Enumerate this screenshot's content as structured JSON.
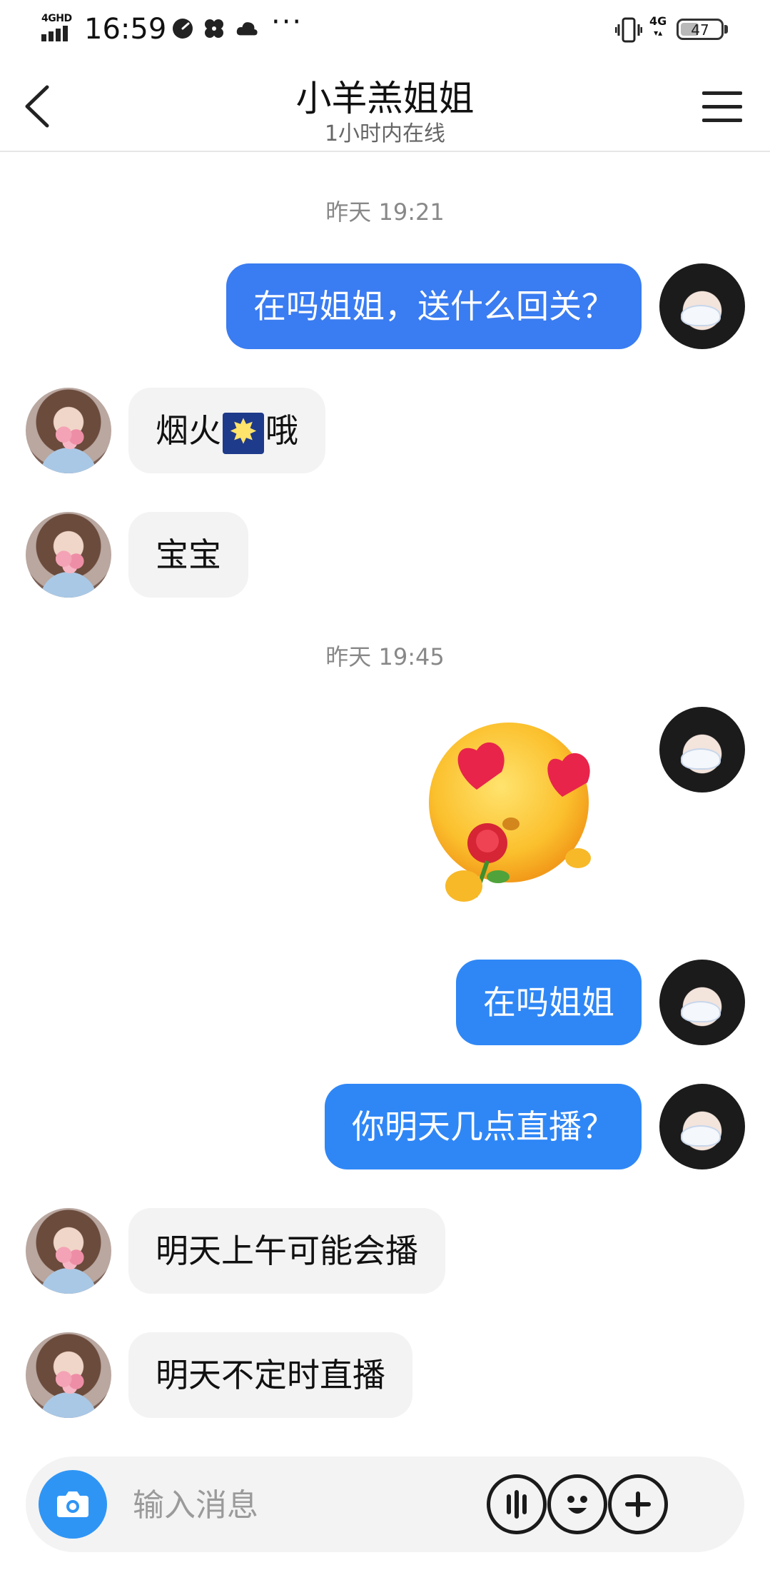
{
  "status_bar": {
    "network_label": "4GHD",
    "time": "16:59",
    "more": "···",
    "network_right": "4G",
    "battery": "47"
  },
  "header": {
    "title": "小羊羔姐姐",
    "subtitle": "1小时内在线"
  },
  "messages": [
    {
      "type": "timestamp",
      "text": "昨天 19:21"
    },
    {
      "type": "text",
      "from": "me",
      "text": "在吗姐姐，送什么回关？"
    },
    {
      "type": "text",
      "from": "them",
      "before": "烟火",
      "emoji": "firework-emoji",
      "after": "哦"
    },
    {
      "type": "text",
      "from": "them",
      "text": "宝宝"
    },
    {
      "type": "timestamp",
      "text": "昨天 19:45"
    },
    {
      "type": "sticker",
      "from": "me",
      "sticker": "heart-eyes-rose-sticker"
    },
    {
      "type": "text",
      "from": "me",
      "text": "在吗姐姐"
    },
    {
      "type": "text",
      "from": "me",
      "text": "你明天几点直播？"
    },
    {
      "type": "text",
      "from": "them",
      "text": "明天上午可能会播"
    },
    {
      "type": "text",
      "from": "them",
      "text": "明天不定时直播"
    }
  ],
  "input": {
    "placeholder": "输入消息",
    "icons": [
      "camera-icon",
      "voice-icon",
      "emoji-icon",
      "plus-icon"
    ]
  },
  "colors": {
    "bubble_me": "#2f87f6",
    "bubble_them": "#f3f3f3",
    "accent": "#2f95f5"
  }
}
